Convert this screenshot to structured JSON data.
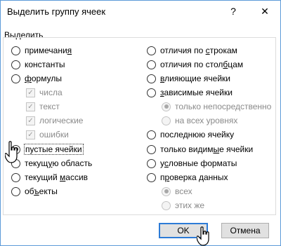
{
  "dialog": {
    "title": "Выделить группу ячеек",
    "help_button": "?",
    "close_button": "✕",
    "section_label": "Выделить"
  },
  "left_options": [
    {
      "pre": "примечани",
      "u": "я",
      "post": "",
      "checked": false
    },
    {
      "pre": "константы",
      "u": "",
      "post": "",
      "checked": false
    },
    {
      "pre": "",
      "u": "ф",
      "post": "ормулы",
      "checked": false
    },
    {
      "pre": "пустые ячейки",
      "u": "",
      "post": "",
      "checked": true
    },
    {
      "pre": "текущ",
      "u": "у",
      "post": "ю область",
      "checked": false
    },
    {
      "pre": "текущий ",
      "u": "м",
      "post": "ассив",
      "checked": false
    },
    {
      "pre": "об",
      "u": "ъ",
      "post": "екты",
      "checked": false
    }
  ],
  "formula_checks": [
    {
      "label": "числа",
      "checked": true
    },
    {
      "label": "текст",
      "checked": true
    },
    {
      "label": "логические",
      "checked": true
    },
    {
      "label": "ошибки",
      "checked": true
    }
  ],
  "right_options": [
    {
      "pre": "отличия по ",
      "u": "с",
      "post": "трокам",
      "checked": false
    },
    {
      "pre": "отличия по стол",
      "u": "б",
      "post": "цам",
      "checked": false
    },
    {
      "pre": "",
      "u": "в",
      "post": "лияющие ячейки",
      "checked": false
    },
    {
      "pre": "",
      "u": "з",
      "post": "ависимые ячейки",
      "checked": false
    },
    {
      "pre": "после",
      "u": "д",
      "post": "нюю ячейку",
      "checked": false
    },
    {
      "pre": "только видим",
      "u": "ы",
      "post": "е ячейки",
      "checked": false
    },
    {
      "pre": "у",
      "u": "с",
      "post": "ловные форматы",
      "checked": false
    },
    {
      "pre": "п",
      "u": "р",
      "post": "оверка данных",
      "checked": false
    }
  ],
  "dependents_sub": [
    {
      "label": "только непосредственно",
      "checked": true
    },
    {
      "label": "на всех уровнях",
      "checked": false
    }
  ],
  "validation_sub": [
    {
      "label": "всех",
      "checked": true
    },
    {
      "label": "этих же",
      "checked": false
    }
  ],
  "buttons": {
    "ok": "OK",
    "cancel": "Отмена"
  }
}
